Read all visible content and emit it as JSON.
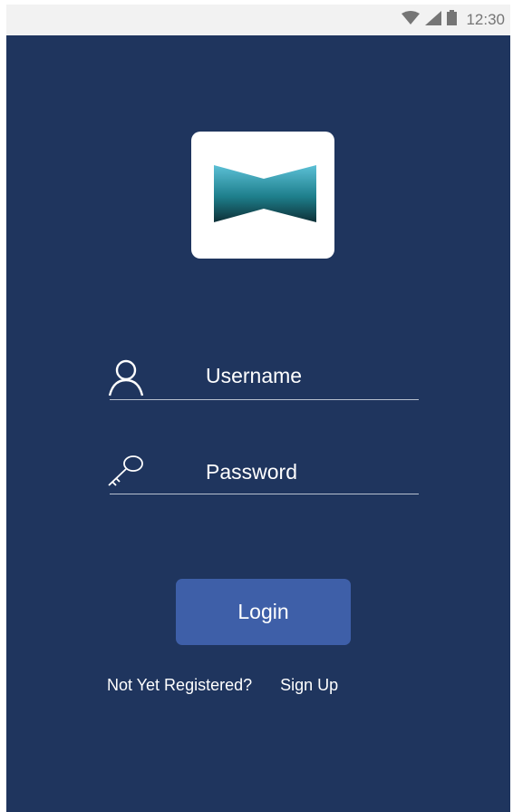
{
  "status_bar": {
    "time": "12:30",
    "icons": [
      "wifi-icon",
      "cellular-signal-icon",
      "battery-icon"
    ]
  },
  "logo": {
    "icon": "bowtie-logo-icon"
  },
  "login_form": {
    "username": {
      "icon": "person-icon",
      "placeholder": "Username"
    },
    "password": {
      "icon": "key-icon",
      "placeholder": "Password"
    },
    "login_button_label": "Login"
  },
  "footer": {
    "prompt": "Not Yet Registered?",
    "signup_link": "Sign Up"
  },
  "colors": {
    "background": "#1f355e",
    "button": "#3e5fa8",
    "status_bar": "#f2f2f2",
    "text": "#ffffff"
  }
}
